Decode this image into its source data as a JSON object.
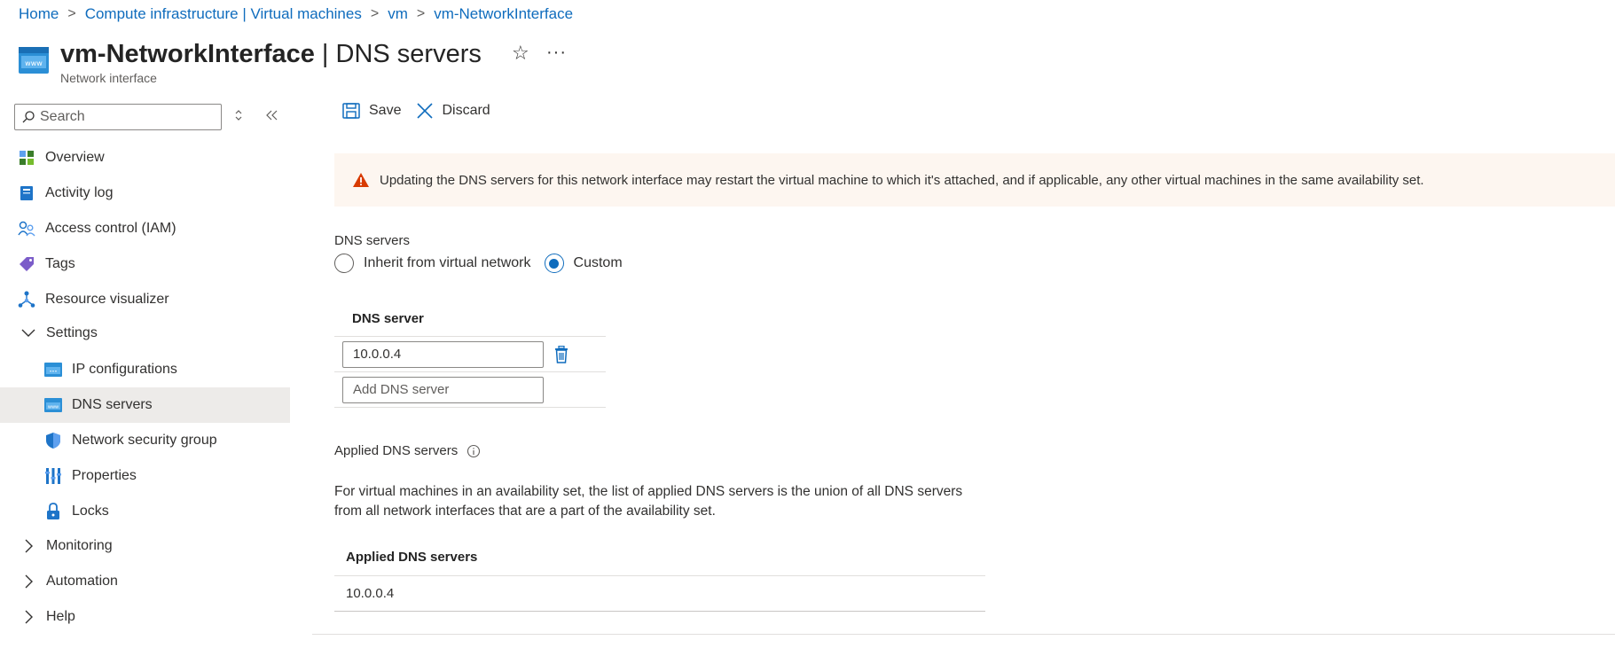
{
  "breadcrumb": {
    "items": [
      "Home",
      "Compute infrastructure | Virtual machines",
      "vm",
      "vm-NetworkInterface"
    ]
  },
  "header": {
    "title_name": "vm-NetworkInterface",
    "title_section": " | DNS servers",
    "subtitle": "Network interface",
    "favorite_icon": "star-icon",
    "more_icon": "more-icon"
  },
  "sidebar": {
    "search_placeholder": "Search",
    "items": [
      {
        "label": "Overview",
        "icon": "overview-icon"
      },
      {
        "label": "Activity log",
        "icon": "activity-log-icon"
      },
      {
        "label": "Access control (IAM)",
        "icon": "iam-icon"
      },
      {
        "label": "Tags",
        "icon": "tag-icon"
      },
      {
        "label": "Resource visualizer",
        "icon": "visualizer-icon"
      },
      {
        "label": "Settings",
        "icon": "chevron-down-icon"
      },
      {
        "label": "IP configurations",
        "icon": "ip-config-icon"
      },
      {
        "label": "DNS servers",
        "icon": "dns-icon"
      },
      {
        "label": "Network security group",
        "icon": "shield-icon"
      },
      {
        "label": "Properties",
        "icon": "properties-icon"
      },
      {
        "label": "Locks",
        "icon": "lock-icon"
      },
      {
        "label": "Monitoring",
        "icon": "chevron-right-icon"
      },
      {
        "label": "Automation",
        "icon": "chevron-right-icon"
      },
      {
        "label": "Help",
        "icon": "chevron-right-icon"
      }
    ]
  },
  "toolbar": {
    "save_label": "Save",
    "discard_label": "Discard"
  },
  "warning": {
    "text": "Updating the DNS servers for this network interface may restart the virtual machine to which it's attached, and if applicable, any other virtual machines in the same availability set.",
    "color": "#d83b01"
  },
  "dns": {
    "label": "DNS servers",
    "option_inherit": "Inherit from virtual network",
    "option_custom": "Custom",
    "selected": "Custom",
    "table_header": "DNS server",
    "servers": [
      "10.0.0.4"
    ],
    "add_placeholder": "Add DNS server"
  },
  "applied": {
    "label": "Applied DNS servers",
    "description": "For virtual machines in an availability set, the list of applied DNS servers is the union of all DNS servers from all network interfaces that are a part of the availability set.",
    "table_header": "Applied DNS servers",
    "rows": [
      "10.0.0.4"
    ]
  },
  "colors": {
    "accent": "#0f6cbd",
    "selected_bg": "#edebe9",
    "warning_bg": "#fdf6f0"
  }
}
